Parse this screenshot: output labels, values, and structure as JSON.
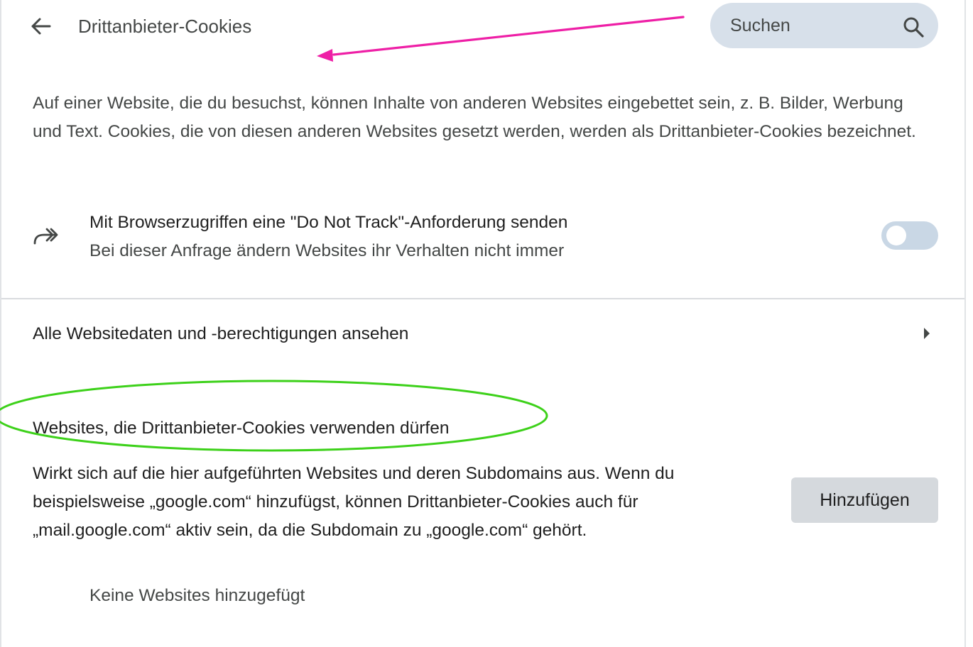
{
  "header": {
    "title": "Drittanbieter-Cookies",
    "back_icon": "arrow-left-icon"
  },
  "search": {
    "placeholder": "Suchen",
    "value": "",
    "icon": "search-icon"
  },
  "description": "Auf einer Website, die du besuchst, können Inhalte von anderen Websites eingebettet sein, z. B. Bilder, Werbung und Text. Cookies, die von diesen anderen Websites gesetzt werden, werden als Drittanbieter-Cookies bezeichnet.",
  "do_not_track": {
    "icon": "double-forward-arrow-icon",
    "title": "Mit Browserzugriffen eine \"Do Not Track\"-Anforderung senden",
    "subtitle": "Bei dieser Anfrage ändern Websites ihr Verhalten nicht immer",
    "enabled": false
  },
  "all_sites": {
    "label": "Alle Websitedaten und -berechtigungen ansehen",
    "icon": "chevron-right-icon"
  },
  "allowed_sites": {
    "title": "Websites, die Drittanbieter-Cookies verwenden dürfen",
    "description": "Wirkt sich auf die hier aufgeführten Websites und deren Subdomains aus. Wenn du beispielsweise „google.com“ hinzufügst, können Drittanbieter-Cookies auch für „mail.google.com“ aktiv sein, da die Subdomain zu „google.com“ gehört.",
    "add_label": "Hinzufügen",
    "empty_text": "Keine Websites hinzugefügt"
  },
  "annotation_colors": {
    "arrow": "#ee1fa6",
    "ellipse": "#3dd11a"
  }
}
